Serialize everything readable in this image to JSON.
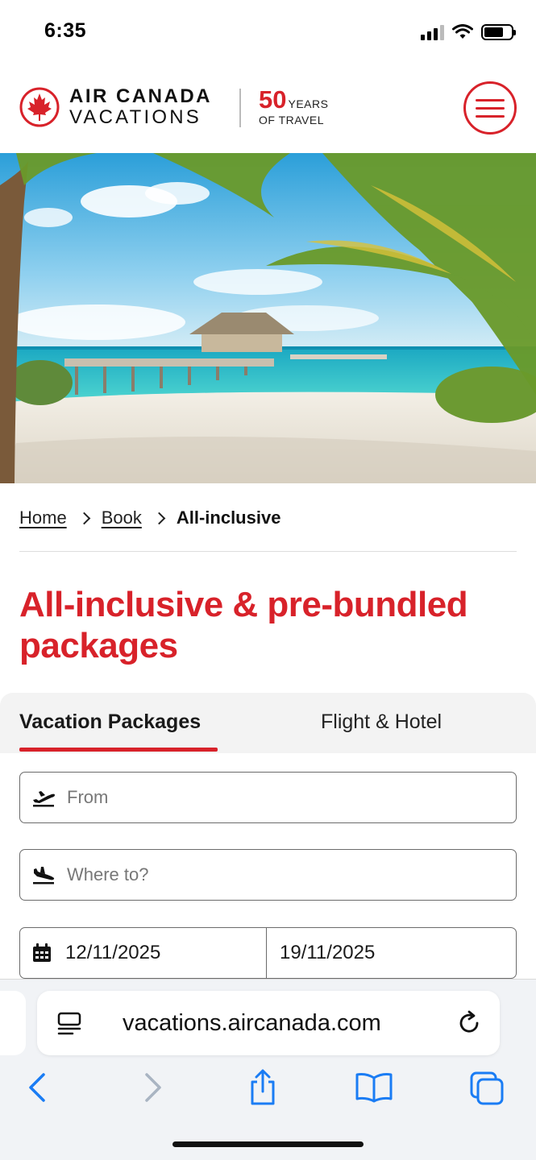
{
  "status_bar": {
    "time": "6:35"
  },
  "header": {
    "brand_line1": "AIR CANADA",
    "brand_line2": "VACATIONS",
    "anniversary_number": "50",
    "anniversary_years": "YEARS",
    "anniversary_travel": "OF TRAVEL",
    "menu_icon": "hamburger-icon"
  },
  "breadcrumb": {
    "items": [
      {
        "label": "Home"
      },
      {
        "label": "Book"
      },
      {
        "label": "All-inclusive"
      }
    ]
  },
  "page": {
    "title": "All-inclusive & pre-bundled packages"
  },
  "tabs": [
    {
      "label": "Vacation Packages",
      "active": true
    },
    {
      "label": "Flight & Hotel",
      "active": false
    }
  ],
  "form": {
    "from": {
      "placeholder": "From",
      "icon": "plane-takeoff-icon"
    },
    "to": {
      "placeholder": "Where to?",
      "icon": "plane-landing-icon"
    },
    "dates": {
      "start": "12/11/2025",
      "end": "19/11/2025",
      "icon": "calendar-icon"
    }
  },
  "browser": {
    "url": "vacations.aircanada.com",
    "icons": [
      "page-menu-icon",
      "reload-icon",
      "back-icon",
      "forward-icon",
      "share-icon",
      "bookmarks-icon",
      "tabs-icon"
    ]
  },
  "colors": {
    "brand_red": "#d8222a",
    "link_blue": "#1a7cf4"
  }
}
